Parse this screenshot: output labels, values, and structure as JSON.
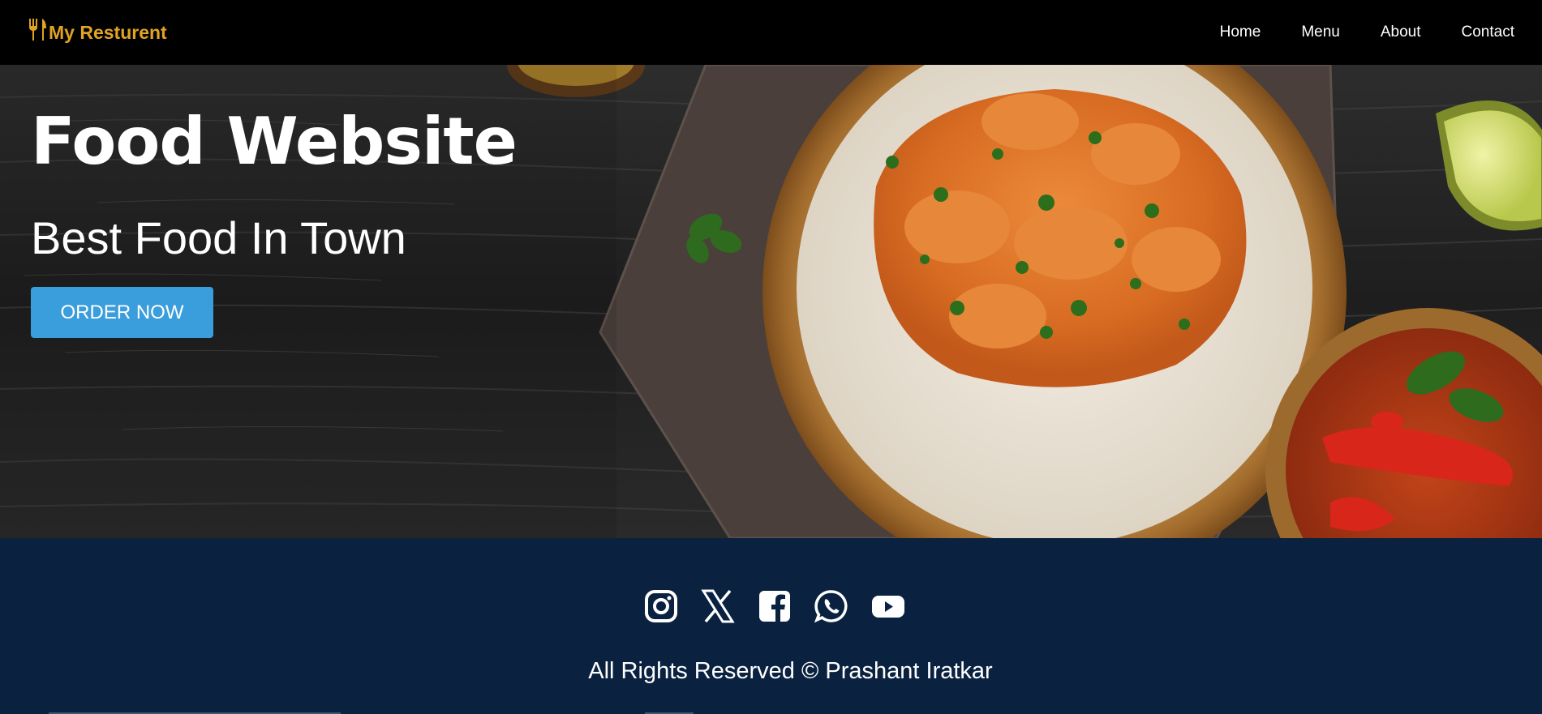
{
  "navbar": {
    "brand_label": "My Resturent",
    "brand_icon": "utensils-icon",
    "links": [
      {
        "label": "Home"
      },
      {
        "label": "Menu"
      },
      {
        "label": "About"
      },
      {
        "label": "Contact"
      }
    ]
  },
  "hero": {
    "title": "Food Website",
    "subtitle": "Best Food In Town",
    "cta_label": "ORDER NOW"
  },
  "footer": {
    "social_icons": [
      "instagram-icon",
      "x-icon",
      "facebook-icon",
      "whatsapp-icon",
      "youtube-icon"
    ],
    "copyright": "All Rights Reserved © Prashant Iratkar"
  },
  "colors": {
    "navbar_bg": "#000000",
    "brand": "#e0a324",
    "cta": "#3a9ddc",
    "footer_bg": "#0a2240"
  }
}
